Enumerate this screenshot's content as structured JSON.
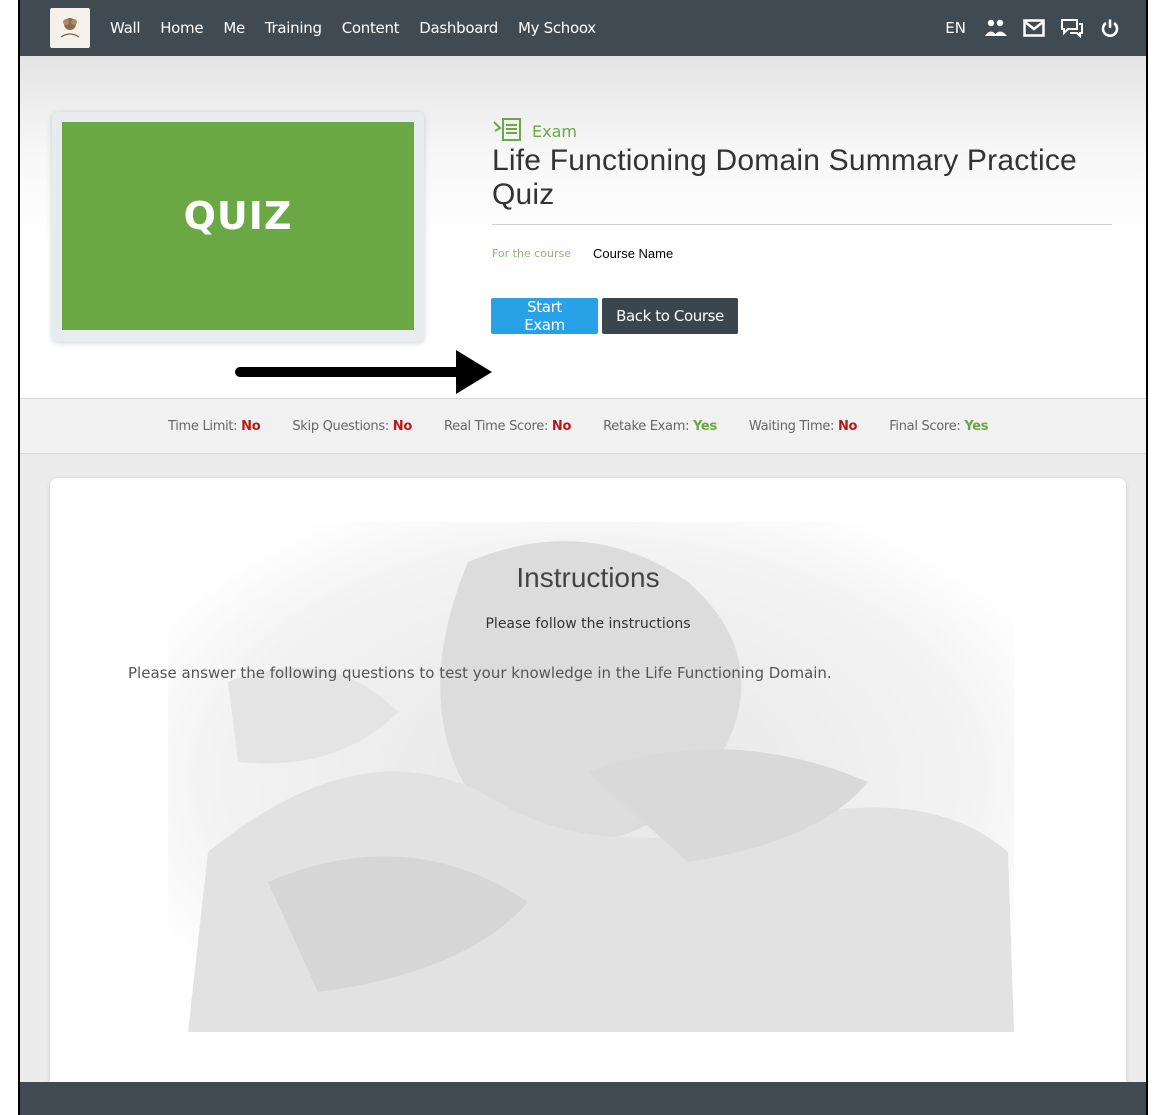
{
  "nav": {
    "links": [
      "Wall",
      "Home",
      "Me",
      "Training",
      "Content",
      "Dashboard",
      "My Schoox"
    ],
    "lang": "EN",
    "icons": [
      "people-icon",
      "mail-icon",
      "chat-icon",
      "power-icon"
    ]
  },
  "exam": {
    "thumbnail_text": "QUIZ",
    "type_label": "Exam",
    "title": "Life Functioning Domain Summary Practice Quiz",
    "course_label": "For the course",
    "course_name": "Course Name",
    "start_button": "Start Exam",
    "back_button": "Back to Course"
  },
  "settings": [
    {
      "label": "Time Limit:",
      "value": "No"
    },
    {
      "label": "Skip Questions:",
      "value": "No"
    },
    {
      "label": "Real Time Score:",
      "value": "No"
    },
    {
      "label": "Retake Exam:",
      "value": "Yes"
    },
    {
      "label": "Waiting Time:",
      "value": "No"
    },
    {
      "label": "Final Score:",
      "value": "Yes"
    }
  ],
  "instructions": {
    "title": "Instructions",
    "subtitle": "Please follow the instructions",
    "body": "Please answer the following questions to test your knowledge in the Life Functioning Domain."
  },
  "colors": {
    "nav_bg": "#3f4a52",
    "accent_green": "#6aa843",
    "start_blue": "#27a2e6",
    "no_red": "#b81818"
  }
}
